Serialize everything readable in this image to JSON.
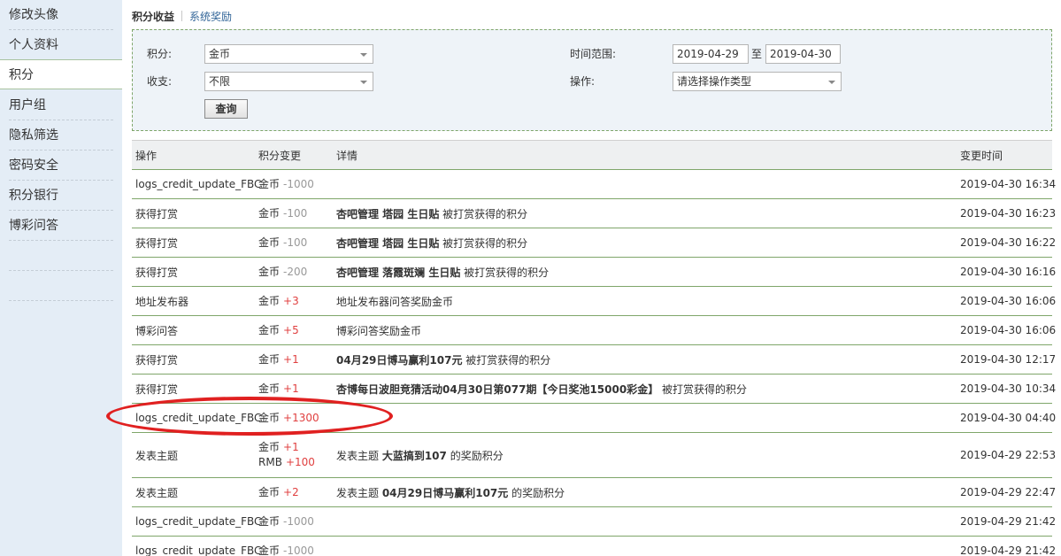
{
  "sidebar": {
    "items": [
      {
        "label": "修改头像"
      },
      {
        "label": "个人资料"
      },
      {
        "label": "积分"
      },
      {
        "label": "用户组"
      },
      {
        "label": "隐私筛选"
      },
      {
        "label": "密码安全"
      },
      {
        "label": "积分银行"
      },
      {
        "label": "博彩问答"
      }
    ],
    "active_index": 2
  },
  "tabs": {
    "active": "积分收益",
    "other": "系统奖励"
  },
  "filter": {
    "credit_label": "积分:",
    "credit_value": "金币",
    "flow_label": "收支:",
    "flow_value": "不限",
    "time_label": "时间范围:",
    "date_from": "2019-04-29",
    "date_to_sep": "至",
    "date_to": "2019-04-30",
    "op_label": "操作:",
    "op_value": "请选择操作类型",
    "query_button": "查询"
  },
  "table": {
    "headers": {
      "op": "操作",
      "change": "积分变更",
      "detail": "详情",
      "time": "变更时间"
    },
    "rows": [
      {
        "op": "logs_credit_update_FBC",
        "changes": [
          {
            "type": "金币",
            "amount": "-1000",
            "sign": "minus"
          }
        ],
        "detail_bold": "",
        "detail_text": "",
        "time": "2019-04-30 16:34"
      },
      {
        "op": "获得打赏",
        "changes": [
          {
            "type": "金币",
            "amount": "-100",
            "sign": "minus"
          }
        ],
        "detail_bold": "杏吧管理 塔园 生日贴",
        "detail_text": " 被打赏获得的积分",
        "time": "2019-04-30 16:23"
      },
      {
        "op": "获得打赏",
        "changes": [
          {
            "type": "金币",
            "amount": "-100",
            "sign": "minus"
          }
        ],
        "detail_bold": "杏吧管理 塔园 生日贴",
        "detail_text": " 被打赏获得的积分",
        "time": "2019-04-30 16:22"
      },
      {
        "op": "获得打赏",
        "changes": [
          {
            "type": "金币",
            "amount": "-200",
            "sign": "minus"
          }
        ],
        "detail_bold": "杏吧管理 落霞斑斓 生日贴",
        "detail_text": " 被打赏获得的积分",
        "time": "2019-04-30 16:16"
      },
      {
        "op": "地址发布器",
        "changes": [
          {
            "type": "金币",
            "amount": "+3",
            "sign": "plus"
          }
        ],
        "detail_bold": "",
        "detail_text": "地址发布器问答奖励金币",
        "time": "2019-04-30 16:06"
      },
      {
        "op": "博彩问答",
        "changes": [
          {
            "type": "金币",
            "amount": "+5",
            "sign": "plus"
          }
        ],
        "detail_bold": "",
        "detail_text": "博彩问答奖励金币",
        "time": "2019-04-30 16:06"
      },
      {
        "op": "获得打赏",
        "changes": [
          {
            "type": "金币",
            "amount": "+1",
            "sign": "plus"
          }
        ],
        "detail_bold": "04月29日博马赢利107元",
        "detail_text": " 被打赏获得的积分",
        "time": "2019-04-30 12:17"
      },
      {
        "op": "获得打赏",
        "changes": [
          {
            "type": "金币",
            "amount": "+1",
            "sign": "plus"
          }
        ],
        "detail_bold": "杏博每日波胆竞猜活动04月30日第077期【今日奖池15000彩金】",
        "detail_text": " 被打赏获得的积分",
        "time": "2019-04-30 10:34"
      },
      {
        "op": "logs_credit_update_FBC",
        "changes": [
          {
            "type": "金币",
            "amount": "+1300",
            "sign": "plus"
          }
        ],
        "detail_bold": "",
        "detail_text": "",
        "time": "2019-04-30 04:40"
      },
      {
        "op": "发表主题",
        "changes": [
          {
            "type": "金币",
            "amount": "+1",
            "sign": "plus"
          },
          {
            "type": "RMB",
            "amount": "+100",
            "sign": "plus"
          }
        ],
        "detail_pre": "发表主题 ",
        "detail_bold": "大蓝搞到107",
        "detail_text": " 的奖励积分",
        "time": "2019-04-29 22:53"
      },
      {
        "op": "发表主题",
        "changes": [
          {
            "type": "金币",
            "amount": "+2",
            "sign": "plus"
          }
        ],
        "detail_pre": "发表主题 ",
        "detail_bold": "04月29日博马赢利107元",
        "detail_text": " 的奖励积分",
        "time": "2019-04-29 22:47"
      },
      {
        "op": "logs_credit_update_FBC",
        "changes": [
          {
            "type": "金币",
            "amount": "-1000",
            "sign": "minus"
          }
        ],
        "detail_bold": "",
        "detail_text": "",
        "time": "2019-04-29 21:42"
      },
      {
        "op": "logs_credit_update_FBC",
        "changes": [
          {
            "type": "金币",
            "amount": "-1000",
            "sign": "minus"
          }
        ],
        "detail_bold": "",
        "detail_text": "",
        "time": "2019-04-29 21:42"
      }
    ]
  },
  "colors": {
    "accent_link": "#336699",
    "plus": "#e04040",
    "minus": "#999999",
    "border_green": "#7fa66a",
    "sidebar_bg": "#e4edf6",
    "annotation": "#e02020"
  }
}
